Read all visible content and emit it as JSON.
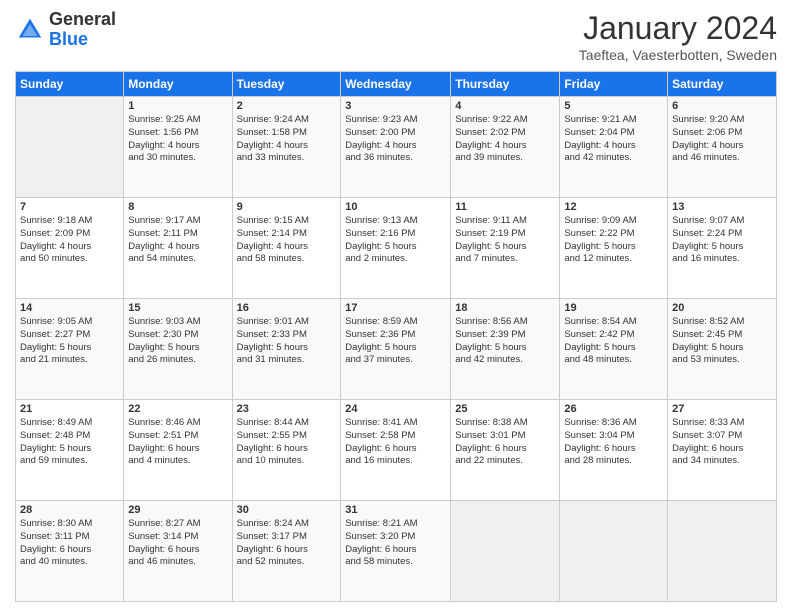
{
  "logo": {
    "general": "General",
    "blue": "Blue"
  },
  "header": {
    "title": "January 2024",
    "subtitle": "Taeftea, Vaesterbotten, Sweden"
  },
  "days_of_week": [
    "Sunday",
    "Monday",
    "Tuesday",
    "Wednesday",
    "Thursday",
    "Friday",
    "Saturday"
  ],
  "weeks": [
    [
      {
        "day": "",
        "info": ""
      },
      {
        "day": "1",
        "info": "Sunrise: 9:25 AM\nSunset: 1:56 PM\nDaylight: 4 hours\nand 30 minutes."
      },
      {
        "day": "2",
        "info": "Sunrise: 9:24 AM\nSunset: 1:58 PM\nDaylight: 4 hours\nand 33 minutes."
      },
      {
        "day": "3",
        "info": "Sunrise: 9:23 AM\nSunset: 2:00 PM\nDaylight: 4 hours\nand 36 minutes."
      },
      {
        "day": "4",
        "info": "Sunrise: 9:22 AM\nSunset: 2:02 PM\nDaylight: 4 hours\nand 39 minutes."
      },
      {
        "day": "5",
        "info": "Sunrise: 9:21 AM\nSunset: 2:04 PM\nDaylight: 4 hours\nand 42 minutes."
      },
      {
        "day": "6",
        "info": "Sunrise: 9:20 AM\nSunset: 2:06 PM\nDaylight: 4 hours\nand 46 minutes."
      }
    ],
    [
      {
        "day": "7",
        "info": "Sunrise: 9:18 AM\nSunset: 2:09 PM\nDaylight: 4 hours\nand 50 minutes."
      },
      {
        "day": "8",
        "info": "Sunrise: 9:17 AM\nSunset: 2:11 PM\nDaylight: 4 hours\nand 54 minutes."
      },
      {
        "day": "9",
        "info": "Sunrise: 9:15 AM\nSunset: 2:14 PM\nDaylight: 4 hours\nand 58 minutes."
      },
      {
        "day": "10",
        "info": "Sunrise: 9:13 AM\nSunset: 2:16 PM\nDaylight: 5 hours\nand 2 minutes."
      },
      {
        "day": "11",
        "info": "Sunrise: 9:11 AM\nSunset: 2:19 PM\nDaylight: 5 hours\nand 7 minutes."
      },
      {
        "day": "12",
        "info": "Sunrise: 9:09 AM\nSunset: 2:22 PM\nDaylight: 5 hours\nand 12 minutes."
      },
      {
        "day": "13",
        "info": "Sunrise: 9:07 AM\nSunset: 2:24 PM\nDaylight: 5 hours\nand 16 minutes."
      }
    ],
    [
      {
        "day": "14",
        "info": "Sunrise: 9:05 AM\nSunset: 2:27 PM\nDaylight: 5 hours\nand 21 minutes."
      },
      {
        "day": "15",
        "info": "Sunrise: 9:03 AM\nSunset: 2:30 PM\nDaylight: 5 hours\nand 26 minutes."
      },
      {
        "day": "16",
        "info": "Sunrise: 9:01 AM\nSunset: 2:33 PM\nDaylight: 5 hours\nand 31 minutes."
      },
      {
        "day": "17",
        "info": "Sunrise: 8:59 AM\nSunset: 2:36 PM\nDaylight: 5 hours\nand 37 minutes."
      },
      {
        "day": "18",
        "info": "Sunrise: 8:56 AM\nSunset: 2:39 PM\nDaylight: 5 hours\nand 42 minutes."
      },
      {
        "day": "19",
        "info": "Sunrise: 8:54 AM\nSunset: 2:42 PM\nDaylight: 5 hours\nand 48 minutes."
      },
      {
        "day": "20",
        "info": "Sunrise: 8:52 AM\nSunset: 2:45 PM\nDaylight: 5 hours\nand 53 minutes."
      }
    ],
    [
      {
        "day": "21",
        "info": "Sunrise: 8:49 AM\nSunset: 2:48 PM\nDaylight: 5 hours\nand 59 minutes."
      },
      {
        "day": "22",
        "info": "Sunrise: 8:46 AM\nSunset: 2:51 PM\nDaylight: 6 hours\nand 4 minutes."
      },
      {
        "day": "23",
        "info": "Sunrise: 8:44 AM\nSunset: 2:55 PM\nDaylight: 6 hours\nand 10 minutes."
      },
      {
        "day": "24",
        "info": "Sunrise: 8:41 AM\nSunset: 2:58 PM\nDaylight: 6 hours\nand 16 minutes."
      },
      {
        "day": "25",
        "info": "Sunrise: 8:38 AM\nSunset: 3:01 PM\nDaylight: 6 hours\nand 22 minutes."
      },
      {
        "day": "26",
        "info": "Sunrise: 8:36 AM\nSunset: 3:04 PM\nDaylight: 6 hours\nand 28 minutes."
      },
      {
        "day": "27",
        "info": "Sunrise: 8:33 AM\nSunset: 3:07 PM\nDaylight: 6 hours\nand 34 minutes."
      }
    ],
    [
      {
        "day": "28",
        "info": "Sunrise: 8:30 AM\nSunset: 3:11 PM\nDaylight: 6 hours\nand 40 minutes."
      },
      {
        "day": "29",
        "info": "Sunrise: 8:27 AM\nSunset: 3:14 PM\nDaylight: 6 hours\nand 46 minutes."
      },
      {
        "day": "30",
        "info": "Sunrise: 8:24 AM\nSunset: 3:17 PM\nDaylight: 6 hours\nand 52 minutes."
      },
      {
        "day": "31",
        "info": "Sunrise: 8:21 AM\nSunset: 3:20 PM\nDaylight: 6 hours\nand 58 minutes."
      },
      {
        "day": "",
        "info": ""
      },
      {
        "day": "",
        "info": ""
      },
      {
        "day": "",
        "info": ""
      }
    ]
  ]
}
